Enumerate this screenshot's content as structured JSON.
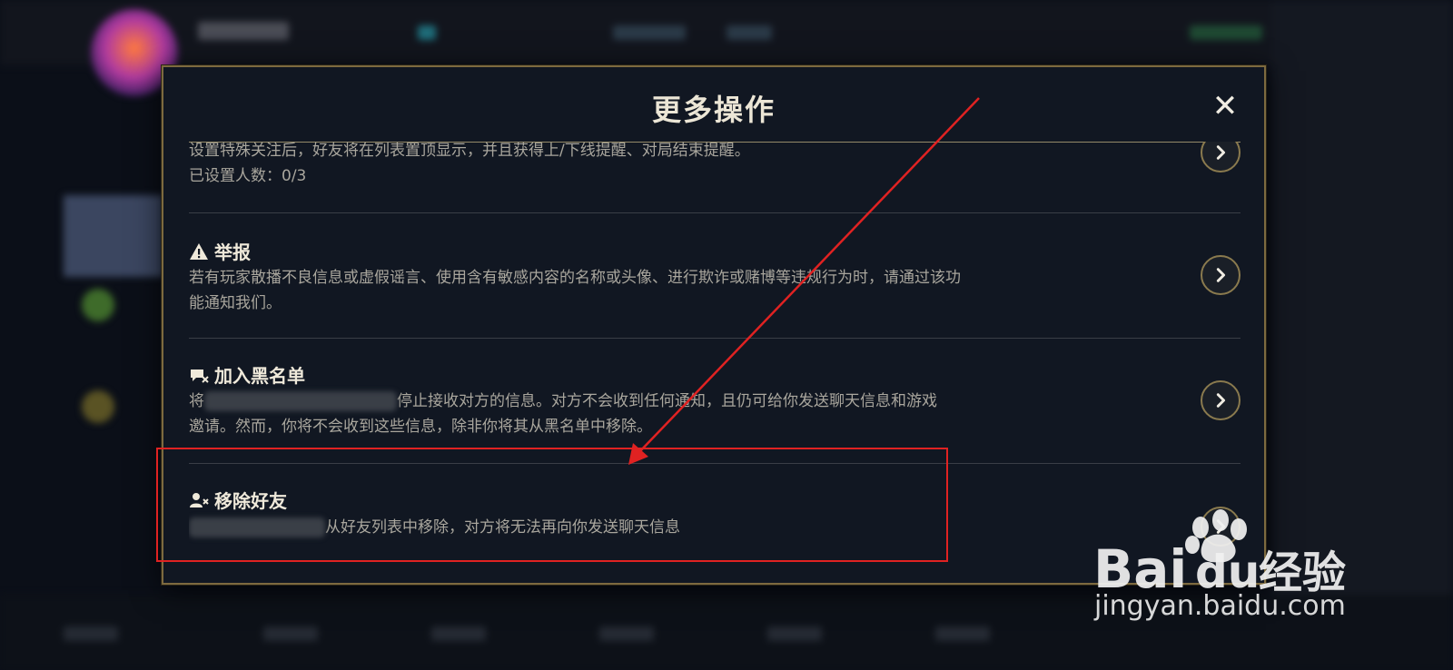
{
  "modal": {
    "title": "更多操作",
    "close_icon": "close-icon"
  },
  "items": [
    {
      "id": "special-follow",
      "title": "",
      "desc_line1": "设置特殊关注后，好友将在列表置顶显示，并且获得上/下线提醒、对局结束提醒。",
      "desc_line2": "已设置人数：0/3",
      "icon": "chevron-right-icon"
    },
    {
      "id": "report",
      "title": "举报",
      "title_icon": "warning-icon",
      "desc_line1": "若有玩家散播不良信息或虚假谣言、使用含有敏感内容的名称或头像、进行欺诈或赌博等违规行为时，请通过该功",
      "desc_line2": "能通知我们。",
      "icon": "chevron-right-icon"
    },
    {
      "id": "blacklist",
      "title": "加入黑名单",
      "title_icon": "chat-block-icon",
      "desc_prefix": "将",
      "desc_line1_rest": "停止接收对方的信息。对方不会收到任何通知，且仍可给你发送聊天信息和游戏",
      "desc_line2": "邀请。然而，你将不会收到这些信息，除非你将其从黑名单中移除。",
      "icon": "chevron-right-icon"
    },
    {
      "id": "remove-friend",
      "title": "移除好友",
      "title_icon": "user-remove-icon",
      "desc_line1_rest": "从好友列表中移除，对方将无法再向你发送聊天信息",
      "icon": "chevron-right-icon"
    }
  ],
  "watermark": {
    "logo_text": "Bai",
    "logo_text2": "du",
    "logo_cn": "经验",
    "url": "jingyan.baidu.com"
  },
  "colors": {
    "modal_bg": "#111722",
    "modal_border": "#7d6a3f",
    "annotation_red": "#e02222"
  }
}
